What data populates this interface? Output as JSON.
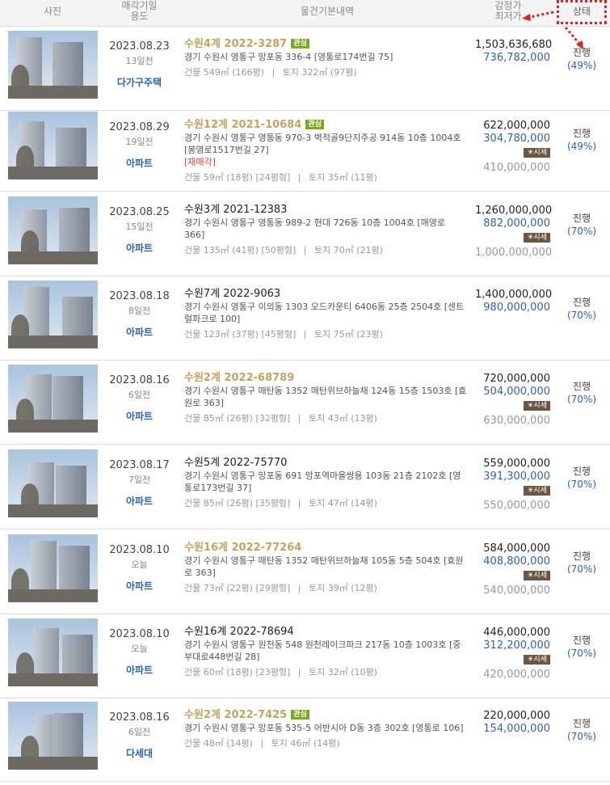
{
  "header": {
    "photo": "사진",
    "date_line1": "매각기일",
    "date_line2": "용도",
    "info": "물건기본내역",
    "price_line1": "감정가",
    "price_line2": "최저가",
    "status": "상태"
  },
  "labels": {
    "building": "건물",
    "land": "토지",
    "market_badge": "☀시세",
    "interest_badge": "관심"
  },
  "listings": [
    {
      "date": "2023.08.23",
      "ago": "13일전",
      "usage": "다가구주택",
      "case": "수원4계 2022-3287",
      "case_gold": true,
      "badge": "관심",
      "addr": "경기 수원시 영통구 망포동 336-4 [영통로174번길 75]",
      "redev": "",
      "area_building": "549㎡ (166평)",
      "area_size": "",
      "area_land": "322㎡ (97평)",
      "appraisal": "1,503,636,680",
      "minimum": "736,782,000",
      "market": "",
      "status": "진행",
      "pct": "(49%)"
    },
    {
      "date": "2023.08.29",
      "ago": "19일전",
      "usage": "아파트",
      "case": "수원12계 2021-10684",
      "case_gold": true,
      "badge": "관심",
      "addr": "경기 수원시 영통구 영통동 970-3 벽적골9단지주공 914동 10층 1004호 [봉영로1517번길 27]",
      "redev": "[재매각]",
      "area_building": "59㎡ (18평)",
      "area_size": "[24평형]",
      "area_land": "35㎡ (11평)",
      "appraisal": "622,000,000",
      "minimum": "304,780,000",
      "market": "410,000,000",
      "status": "진행",
      "pct": "(49%)"
    },
    {
      "date": "2023.08.25",
      "ago": "15일전",
      "usage": "아파트",
      "case": "수원3계 2021-12383",
      "case_gold": false,
      "badge": "",
      "addr": "경기 수원시 영통구 영통동 989-2 현대 726동 10층 1004호 [매영로 366]",
      "redev": "",
      "area_building": "135㎡ (41평)",
      "area_size": "[50평형]",
      "area_land": "70㎡ (21평)",
      "appraisal": "1,260,000,000",
      "minimum": "882,000,000",
      "market": "1,000,000,000",
      "status": "진행",
      "pct": "(70%)"
    },
    {
      "date": "2023.08.18",
      "ago": "8일전",
      "usage": "아파트",
      "case": "수원7계 2022-9063",
      "case_gold": false,
      "badge": "",
      "addr": "경기 수원시 영통구 이의동 1303 오드카운티 6406동 25층 2504호 [센트럴파크로 100]",
      "redev": "",
      "area_building": "123㎡ (37평)",
      "area_size": "[45평형]",
      "area_land": "75㎡ (23평)",
      "appraisal": "1,400,000,000",
      "minimum": "980,000,000",
      "market": "",
      "status": "진행",
      "pct": "(70%)"
    },
    {
      "date": "2023.08.16",
      "ago": "6일전",
      "usage": "아파트",
      "case": "수원2계 2022-68789",
      "case_gold": true,
      "badge": "",
      "addr": "경기 수원시 영통구 매탄동 1352 매탄위브하늘채 124동 15층 1503호 [효원로 363]",
      "redev": "",
      "area_building": "85㎡ (26평)",
      "area_size": "[32평형]",
      "area_land": "43㎡ (13평)",
      "appraisal": "720,000,000",
      "minimum": "504,000,000",
      "market": "630,000,000",
      "status": "진행",
      "pct": "(70%)"
    },
    {
      "date": "2023.08.17",
      "ago": "7일전",
      "usage": "아파트",
      "case": "수원5계 2022-75770",
      "case_gold": false,
      "badge": "",
      "addr": "경기 수원시 영통구 망포동 691 망포역마을쌍용 103동 21층 2102호 [영통로173번길 37]",
      "redev": "",
      "area_building": "85㎡ (26평)",
      "area_size": "[35평형]",
      "area_land": "47㎡ (14평)",
      "appraisal": "559,000,000",
      "minimum": "391,300,000",
      "market": "550,000,000",
      "status": "진행",
      "pct": "(70%)"
    },
    {
      "date": "2023.08.10",
      "ago": "오늘",
      "usage": "아파트",
      "case": "수원16계 2022-77264",
      "case_gold": true,
      "badge": "",
      "addr": "경기 수원시 영통구 매탄동 1352 매탄위브하늘채 105동 5층 504호 [효원로 363]",
      "redev": "",
      "area_building": "73㎡ (22평)",
      "area_size": "[29평형]",
      "area_land": "39㎡ (12평)",
      "appraisal": "584,000,000",
      "minimum": "408,800,000",
      "market": "540,000,000",
      "status": "진행",
      "pct": "(70%)"
    },
    {
      "date": "2023.08.10",
      "ago": "오늘",
      "usage": "아파트",
      "case": "수원16계 2022-78694",
      "case_gold": false,
      "badge": "",
      "addr": "경기 수원시 영통구 원천동 548 원천레이크파크 217동 10층 1003호 [중부대로448번길 28]",
      "redev": "",
      "area_building": "60㎡ (18평)",
      "area_size": "[23평형]",
      "area_land": "32㎡ (10평)",
      "appraisal": "446,000,000",
      "minimum": "312,200,000",
      "market": "420,000,000",
      "status": "진행",
      "pct": "(70%)"
    },
    {
      "date": "2023.08.16",
      "ago": "6일전",
      "usage": "다세대",
      "case": "수원2계 2022-7425",
      "case_gold": true,
      "badge": "관심",
      "addr": "경기 수원시 영통구 망포동 535-5 어반시아 D동 3층 302호 [영통로 106]",
      "redev": "",
      "area_building": "48㎡ (14평)",
      "area_size": "",
      "area_land": "46㎡ (14평)",
      "appraisal": "220,000,000",
      "minimum": "154,000,000",
      "market": "",
      "status": "진행",
      "pct": "(70%)"
    }
  ]
}
